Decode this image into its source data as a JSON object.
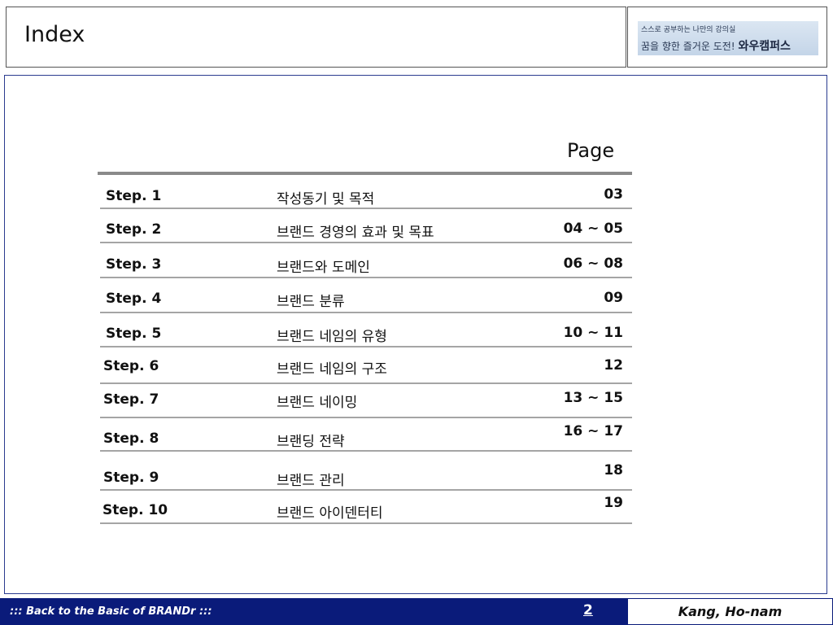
{
  "header": {
    "title": "Index",
    "logo_line1": "스스로 공부하는 나만의 강의실",
    "logo_line2": "꿈을 향한 즐거운 도전!",
    "logo_brand": "와우캠퍼스"
  },
  "toc": {
    "page_heading": "Page",
    "rows": [
      {
        "step": "Step. 1",
        "title": "작성동기 및 목적",
        "pages": "03"
      },
      {
        "step": "Step. 2",
        "title": "브랜드 경영의 효과 및 목표",
        "pages": "04 ~ 05"
      },
      {
        "step": "Step. 3",
        "title": "브랜드와 도메인",
        "pages": "06 ~ 08"
      },
      {
        "step": "Step. 4",
        "title": "브랜드 분류",
        "pages": "09"
      },
      {
        "step": "Step. 5",
        "title": "브랜드 네임의 유형",
        "pages": "10 ~ 11"
      },
      {
        "step": "Step. 6",
        "title": "브랜드 네임의 구조",
        "pages": "12"
      },
      {
        "step": "Step. 7",
        "title": "브랜드 네이밍",
        "pages": "13 ~ 15"
      },
      {
        "step": "Step. 8",
        "title": "브랜딩 전략",
        "pages": "16 ~ 17"
      },
      {
        "step": "Step. 9",
        "title": "브랜드 관리",
        "pages": "18"
      },
      {
        "step": "Step. 10",
        "title": "브랜드 아이덴터티",
        "pages": "19"
      }
    ]
  },
  "footer": {
    "tagline": "::: Back to the Basic of  BRANDr  :::",
    "page_number": "2",
    "author": "Kang, Ho-nam"
  }
}
